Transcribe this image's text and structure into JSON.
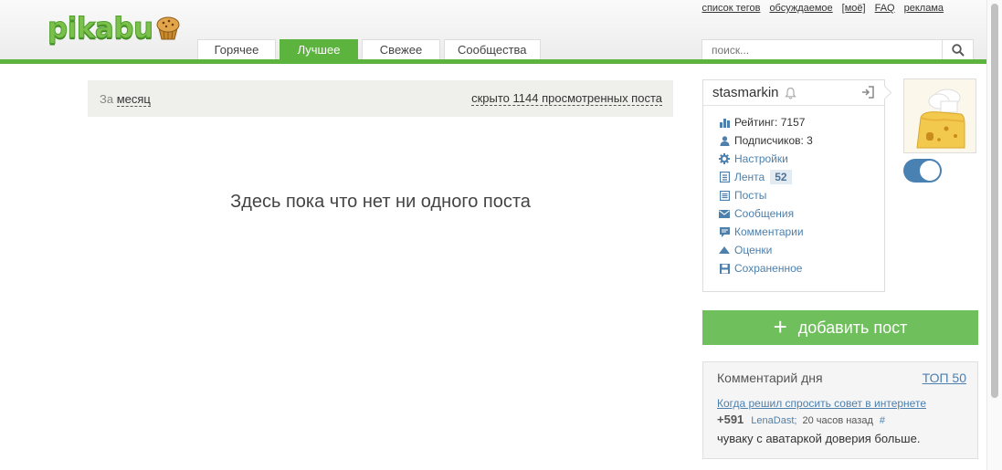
{
  "header": {
    "logo": "pikabu",
    "top_links": [
      "список тегов",
      "обсуждаемое",
      "[моё]",
      "FAQ",
      "реклама"
    ],
    "tabs": [
      {
        "label": "Горячее",
        "active": false
      },
      {
        "label": "Лучшее",
        "active": true
      },
      {
        "label": "Свежее",
        "active": false
      },
      {
        "label": "Сообщества",
        "active": false
      }
    ],
    "search": {
      "placeholder": "поиск..."
    }
  },
  "main": {
    "filter_prefix": "За",
    "filter_period": "месяц",
    "hidden_posts": "скрыто 1144 просмотренных поста",
    "empty_message": "Здесь пока что нет ни одного поста"
  },
  "user": {
    "username": "stasmarkin",
    "rating": "Рейтинг: 7157",
    "subscribers": "Подписчиков: 3",
    "menu": [
      {
        "label": "Настройки",
        "icon": "gear-icon"
      },
      {
        "label": "Лента",
        "icon": "feed-icon",
        "badge": "52"
      },
      {
        "label": "Посты",
        "icon": "posts-icon"
      },
      {
        "label": "Сообщения",
        "icon": "envelope-icon"
      },
      {
        "label": "Комментарии",
        "icon": "comment-icon"
      },
      {
        "label": "Оценки",
        "icon": "rating-arrow-icon"
      },
      {
        "label": "Сохраненное",
        "icon": "save-icon"
      }
    ]
  },
  "add_post_label": "добавить пост",
  "comment_of_day": {
    "title": "Комментарий дня",
    "top_link": "ТОП 50",
    "post_title": "Когда решил спросить совет в интернете",
    "score": "+591",
    "author": "LenaDast;",
    "time": "20 часов назад",
    "hash": "#",
    "text": "чуваку с аватаркой доверия больше."
  },
  "colors": {
    "brand_green": "#5cb33e",
    "button_green": "#6fbf5c",
    "link_blue": "#4d80ad"
  }
}
